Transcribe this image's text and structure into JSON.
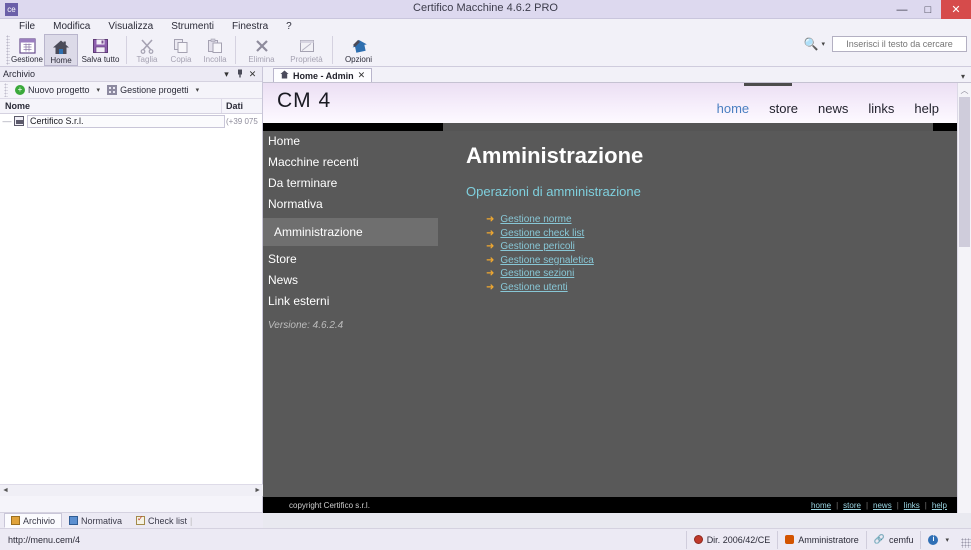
{
  "window": {
    "title": "Certifico Macchine 4.6.2 PRO",
    "app_icon": "ce-icon",
    "minimize": "—",
    "maximize": "□",
    "close": "✕"
  },
  "menubar": {
    "items": [
      {
        "label": "File"
      },
      {
        "label": "Modifica"
      },
      {
        "label": "Visualizza"
      },
      {
        "label": "Strumenti"
      },
      {
        "label": "Finestra"
      },
      {
        "label": "?"
      }
    ]
  },
  "toolbar": {
    "buttons": [
      {
        "label": "Gestione",
        "icon": "grid-calendar-icon",
        "state": "normal"
      },
      {
        "label": "Home",
        "icon": "home-icon",
        "state": "active"
      },
      {
        "label": "Salva tutto",
        "icon": "save-all-icon",
        "state": "normal"
      },
      {
        "label": "Taglia",
        "icon": "scissors-icon",
        "state": "disabled"
      },
      {
        "label": "Copia",
        "icon": "copy-icon",
        "state": "disabled"
      },
      {
        "label": "Incolla",
        "icon": "paste-icon",
        "state": "disabled"
      },
      {
        "label": "Elimina",
        "icon": "delete-x-icon",
        "state": "disabled"
      },
      {
        "label": "Proprietà",
        "icon": "properties-icon",
        "state": "disabled"
      },
      {
        "label": "Opzioni",
        "icon": "options-home-icon",
        "state": "normal"
      }
    ],
    "search": {
      "icon": "search-icon",
      "caret": "▾",
      "placeholder": "Inserisci il testo da cercare",
      "value": ""
    }
  },
  "archive_panel": {
    "title": "Archivio",
    "header_icons": {
      "dropdown": "▾",
      "pin": "pin-icon",
      "close": "✕"
    },
    "toolbar": {
      "new_project": "Nuovo progetto",
      "new_project_icon": "plus-circle-icon",
      "new_project_caret": "▾",
      "manage_projects": "Gestione progetti",
      "manage_projects_icon": "grid-icon",
      "manage_projects_caret": "▾"
    },
    "tree": {
      "columns": [
        "Nome",
        "Dati"
      ],
      "rows": [
        {
          "name": "Certifico S.r.l.",
          "data": "(+39 075",
          "icon": "company-node-icon"
        }
      ]
    },
    "hscroll": {
      "left_arrow": "◄",
      "right_arrow": "►"
    }
  },
  "dock_tabs": {
    "items": [
      {
        "label": "Archivio",
        "icon": "archive-icon",
        "active": true
      },
      {
        "label": "Normativa",
        "icon": "book-icon",
        "active": false
      },
      {
        "label": "Check list",
        "icon": "checklist-icon",
        "active": false
      }
    ]
  },
  "document": {
    "tab": {
      "label": "Home - Admin",
      "icon": "home-icon",
      "close": "✕"
    },
    "tabstrip_caret": "▾",
    "scrollbar": {
      "up_arrow": "︿",
      "down_arrow": "﹀"
    }
  },
  "page": {
    "brand": "CM 4",
    "topnav": [
      {
        "label": "home",
        "active": true
      },
      {
        "label": "store",
        "active": false
      },
      {
        "label": "news",
        "active": false
      },
      {
        "label": "links",
        "active": false
      },
      {
        "label": "help",
        "active": false
      }
    ],
    "sidemenu": [
      {
        "label": "Home",
        "active": false
      },
      {
        "label": "Macchine recenti",
        "active": false
      },
      {
        "label": "Da terminare",
        "active": false
      },
      {
        "label": "Normativa",
        "active": false
      },
      {
        "label": "Amministrazione",
        "active": true
      },
      {
        "label": "Store",
        "active": false
      },
      {
        "label": "News",
        "active": false
      },
      {
        "label": "Link esterni",
        "active": false
      }
    ],
    "version": "Versione: 4.6.2.4",
    "content": {
      "heading": "Amministrazione",
      "subheading": "Operazioni di amministrazione",
      "arrow_icon": "➜",
      "links": [
        {
          "label": "Gestione norme"
        },
        {
          "label": "Gestione check list"
        },
        {
          "label": "Gestione pericoli"
        },
        {
          "label": "Gestione segnaletica"
        },
        {
          "label": "Gestione sezioni"
        },
        {
          "label": "Gestione utenti"
        }
      ]
    },
    "footer": {
      "copyright": "copyright Certifico s.r.l.",
      "links": [
        "home",
        "store",
        "news",
        "links",
        "help"
      ],
      "separator": "|"
    }
  },
  "statusbar": {
    "url": "http://menu.cem/4",
    "cells": [
      {
        "label": "Dir. 2006/42/CE",
        "icon": "seal-icon"
      },
      {
        "label": "Amministratore",
        "icon": "user-icon"
      },
      {
        "label": "cemfu",
        "icon": "link-icon"
      }
    ],
    "info_icon": "info-icon",
    "info_caret": "▾"
  },
  "colors": {
    "titlebar": "#ddd9ef",
    "close_button": "#d64b4b",
    "page_dark": "#595959",
    "accent_link": "#88c7d6",
    "accent_arrow": "#f0a830",
    "nav_active": "#4a7fc1"
  }
}
